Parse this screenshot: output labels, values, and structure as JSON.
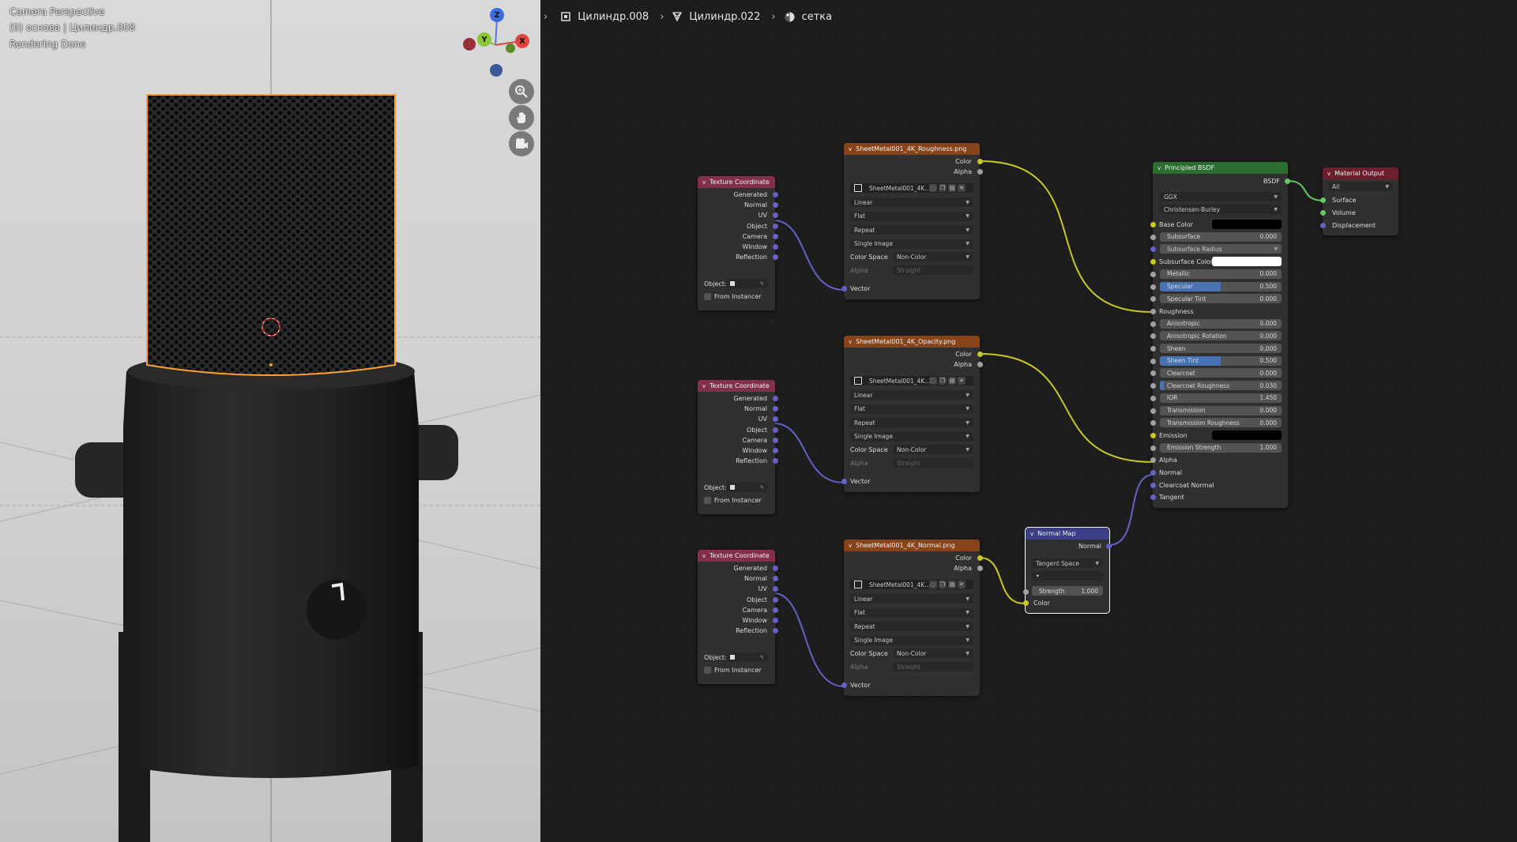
{
  "viewport": {
    "overlay_lines": [
      "Camera Perspective",
      "(0) основа | Цилиндр.008",
      "Rendering Done"
    ],
    "gizmo": {
      "z": "Z",
      "y": "Y",
      "x": "X"
    },
    "nav_icons": [
      "zoom-icon",
      "pan-hand-icon",
      "camera-view-icon"
    ]
  },
  "breadcrumb": [
    {
      "label": "Цилиндр.008",
      "icon": "object-icon"
    },
    {
      "label": "Цилиндр.022",
      "icon": "mesh-icon"
    },
    {
      "label": "сетка",
      "icon": "material-icon"
    }
  ],
  "nodes": {
    "texcoord": {
      "title": "Texture Coordinate",
      "outputs": [
        "Generated",
        "Normal",
        "UV",
        "Object",
        "Camera",
        "Window",
        "Reflection"
      ],
      "object_label": "Object:",
      "from_instancer": "From Instancer"
    },
    "image_textures": [
      {
        "title": "SheetMetal001_4K_Roughness.png"
      },
      {
        "title": "SheetMetal001_4K_Opacity.png"
      },
      {
        "title": "SheetMetal001_4K_Normal.png"
      }
    ],
    "image_common": {
      "outputs": [
        "Color",
        "Alpha"
      ],
      "image_name": "SheetMetal001_4K...",
      "interpolation": "Linear",
      "projection": "Flat",
      "extension": "Repeat",
      "source": "Single Image",
      "color_space_label": "Color Space",
      "color_space": "Non-Color",
      "alpha_label": "Alpha",
      "alpha_value": "Straight",
      "vector_input": "Vector"
    },
    "principled": {
      "title": "Principled BSDF",
      "output": "BSDF",
      "distribution": "GGX",
      "subsurface_method": "Christensen-Burley",
      "base_color_label": "Base Color",
      "subsurface": {
        "label": "Subsurface",
        "value": "0.000"
      },
      "subsurface_radius": "Subsurface Radius",
      "subsurface_color_label": "Subsurface Color",
      "sliders": [
        {
          "label": "Metallic",
          "value": "0.000",
          "fill": 0
        },
        {
          "label": "Specular",
          "value": "0.500",
          "fill": 0.5
        },
        {
          "label": "Specular Tint",
          "value": "0.000",
          "fill": 0
        }
      ],
      "roughness_label": "Roughness",
      "sliders2": [
        {
          "label": "Anisotropic",
          "value": "0.000",
          "fill": 0
        },
        {
          "label": "Anisotropic Rotation",
          "value": "0.000",
          "fill": 0
        },
        {
          "label": "Sheen",
          "value": "0.000",
          "fill": 0
        },
        {
          "label": "Sheen Tint",
          "value": "0.500",
          "fill": 0.5
        },
        {
          "label": "Clearcoat",
          "value": "0.000",
          "fill": 0
        },
        {
          "label": "Clearcoat Roughness",
          "value": "0.030",
          "fill": 0.03
        },
        {
          "label": "IOR",
          "value": "1.450",
          "fill": 0
        },
        {
          "label": "Transmission",
          "value": "0.000",
          "fill": 0
        },
        {
          "label": "Transmission Roughness",
          "value": "0.000",
          "fill": 0
        }
      ],
      "emission_label": "Emission",
      "emission_strength": {
        "label": "Emission Strength",
        "value": "1.000"
      },
      "inputs_tail": [
        "Alpha",
        "Normal",
        "Clearcoat Normal",
        "Tangent"
      ],
      "colors": {
        "base": "#000000",
        "subsurface": "#ffffff",
        "emission": "#000000"
      }
    },
    "material_output": {
      "title": "Material Output",
      "target": "All",
      "inputs": [
        "Surface",
        "Volume",
        "Displacement"
      ]
    },
    "normal_map": {
      "title": "Normal Map",
      "output": "Normal",
      "space": "Tangent Space",
      "strength_label": "Strength",
      "strength_value": "1.000",
      "color_input": "Color"
    }
  },
  "colors": {
    "socket_color": "#c7c729",
    "socket_float": "#a1a1a1",
    "socket_vector": "#6363c7",
    "socket_shader": "#63c763",
    "selection_outline": "#ffa033"
  }
}
